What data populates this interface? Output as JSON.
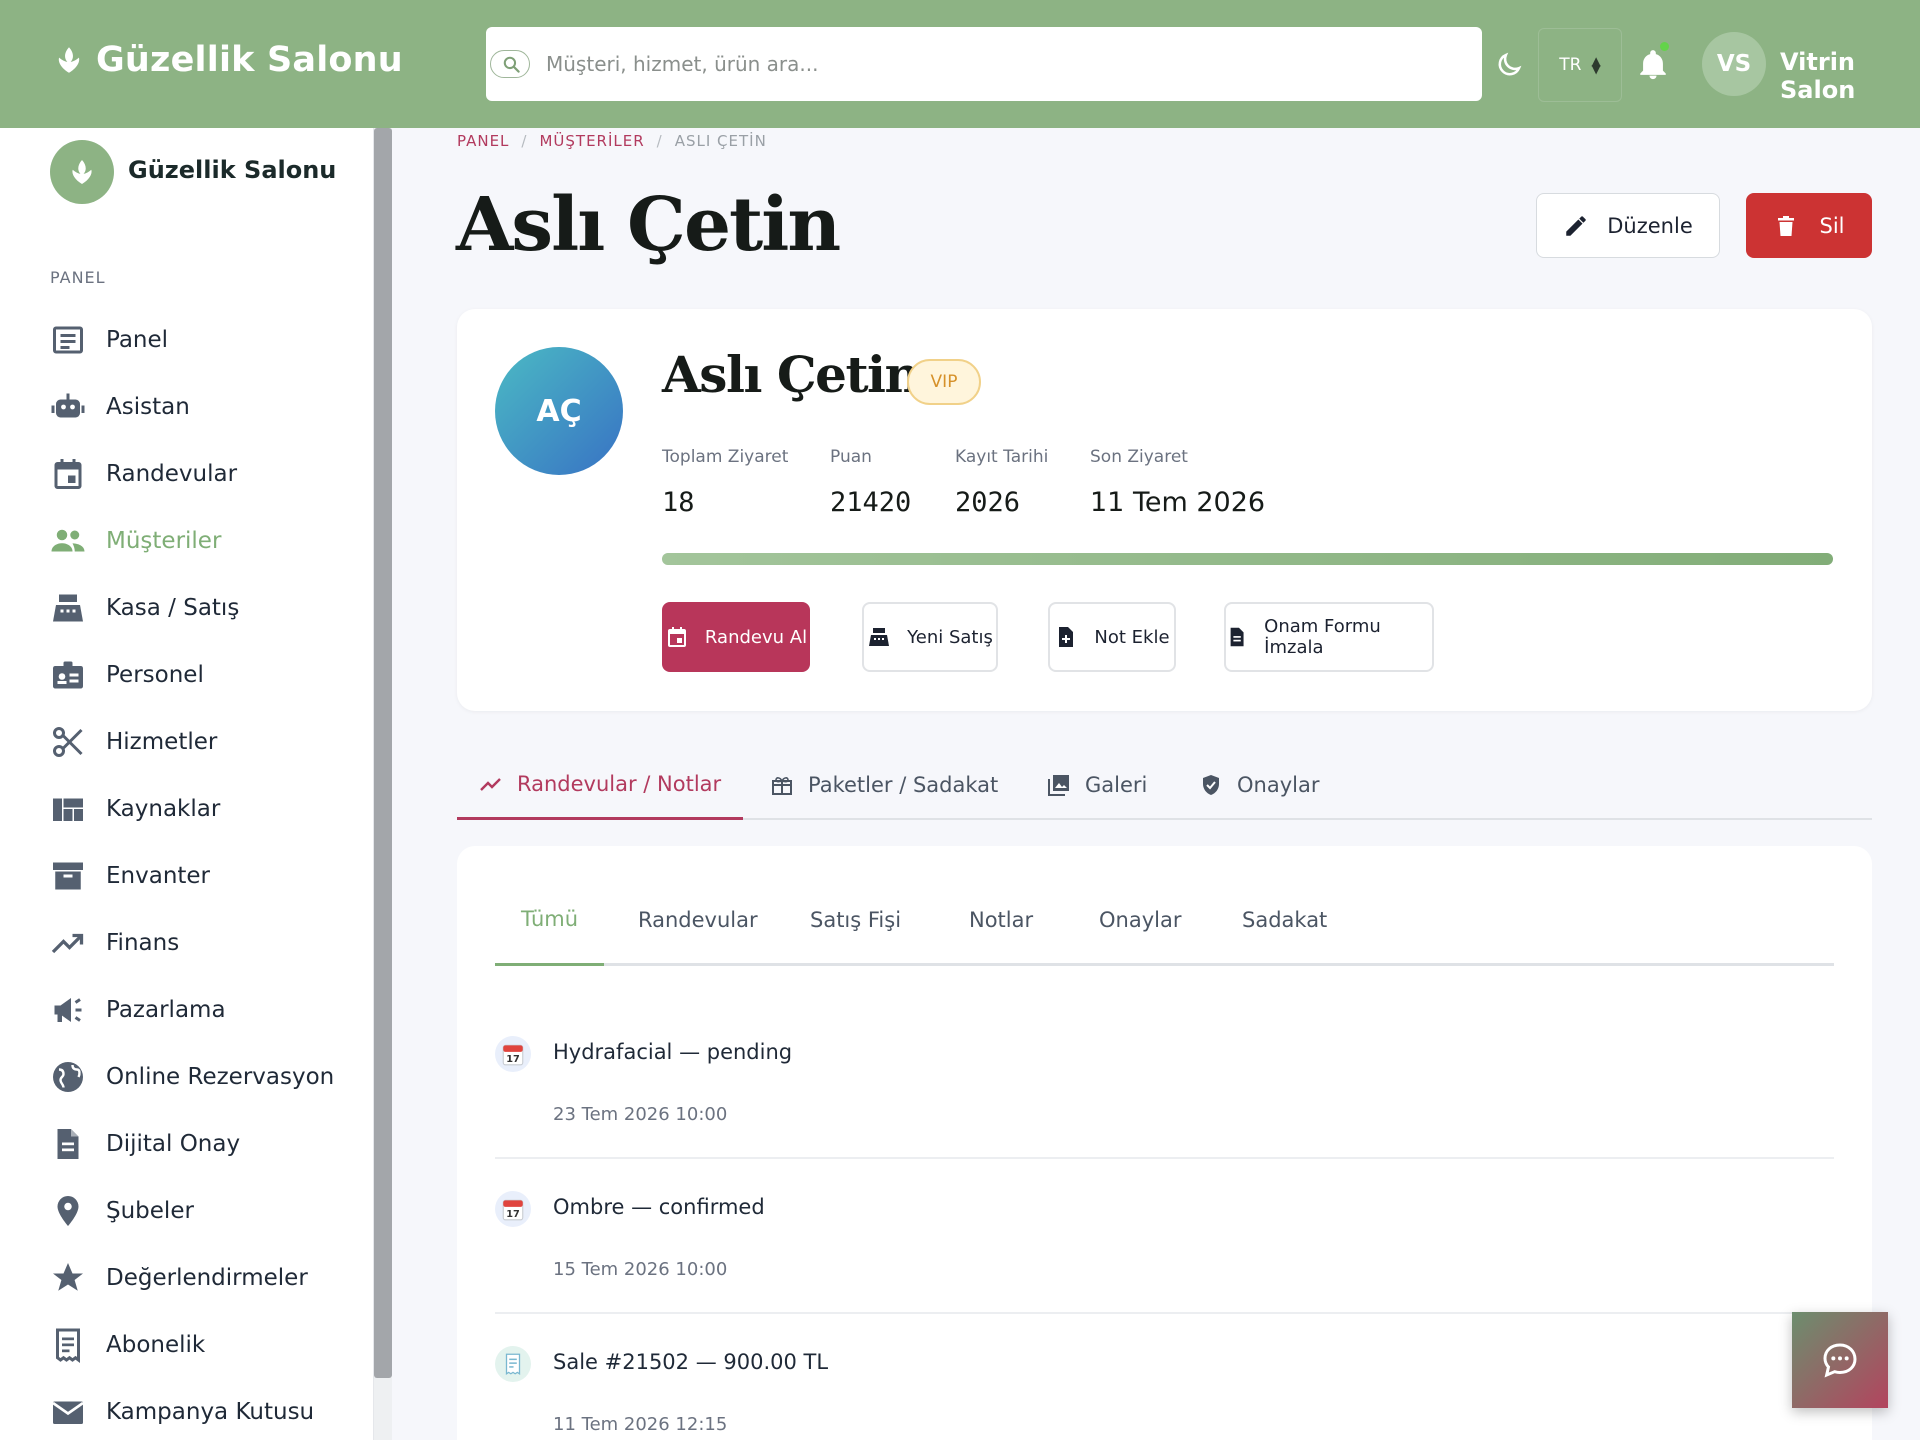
{
  "colors": {
    "brand_green": "#8db384",
    "accent_rose": "#b8365a",
    "danger": "#cc3333",
    "vip_gold": "#d6912a"
  },
  "topbar": {
    "brand": "Güzellik Salonu",
    "search_placeholder": "Müşteri, hizmet, ürün ara...",
    "language": "TR",
    "user_initials": "VS",
    "user_name": "Vitrin Salon"
  },
  "sidebar": {
    "title": "Güzellik Salonu",
    "section": "PANEL",
    "items": [
      {
        "label": "Panel",
        "icon": "dashboard-icon",
        "active": false
      },
      {
        "label": "Asistan",
        "icon": "robot-icon",
        "active": false
      },
      {
        "label": "Randevular",
        "icon": "calendar-icon",
        "active": false
      },
      {
        "label": "Müşteriler",
        "icon": "people-icon",
        "active": true
      },
      {
        "label": "Kasa / Satış",
        "icon": "cash-register-icon",
        "active": false
      },
      {
        "label": "Personel",
        "icon": "badge-icon",
        "active": false
      },
      {
        "label": "Hizmetler",
        "icon": "scissors-icon",
        "active": false
      },
      {
        "label": "Kaynaklar",
        "icon": "grid-icon",
        "active": false
      },
      {
        "label": "Envanter",
        "icon": "archive-icon",
        "active": false
      },
      {
        "label": "Finans",
        "icon": "trending-up-icon",
        "active": false
      },
      {
        "label": "Pazarlama",
        "icon": "megaphone-icon",
        "active": false
      },
      {
        "label": "Online Rezervasyon",
        "icon": "globe-icon",
        "active": false
      },
      {
        "label": "Dijital Onay",
        "icon": "document-icon",
        "active": false
      },
      {
        "label": "Şubeler",
        "icon": "location-pin-icon",
        "active": false
      },
      {
        "label": "Değerlendirmeler",
        "icon": "star-icon",
        "active": false
      },
      {
        "label": "Abonelik",
        "icon": "receipt-icon",
        "active": false
      },
      {
        "label": "Kampanya Kutusu",
        "icon": "mail-icon",
        "active": false
      }
    ]
  },
  "breadcrumb": {
    "items": [
      "PANEL",
      "MÜŞTERİLER",
      "ASLI ÇETİN"
    ]
  },
  "page": {
    "title": "Aslı Çetin",
    "edit_label": "Düzenle",
    "delete_label": "Sil"
  },
  "customer": {
    "initials": "AÇ",
    "name": "Aslı Çetin",
    "badge": "VIP",
    "stats": [
      {
        "label": "Toplam Ziyaret",
        "value": "18"
      },
      {
        "label": "Puan",
        "value": "21420"
      },
      {
        "label": "Kayıt Tarihi",
        "value": "2026"
      },
      {
        "label": "Son Ziyaret",
        "value": "11 Tem 2026"
      }
    ],
    "progress": 1.0,
    "actions": [
      {
        "label": "Randevu Al",
        "icon": "calendar-icon"
      },
      {
        "label": "Yeni Satış",
        "icon": "cash-register-icon"
      },
      {
        "label": "Not Ekle",
        "icon": "note-add-icon"
      },
      {
        "label": "Onam Formu İmzala",
        "icon": "document-icon"
      }
    ]
  },
  "tabs": [
    {
      "label": "Randevular / Notlar",
      "icon": "trending-up-icon",
      "active": true
    },
    {
      "label": "Paketler / Sadakat",
      "icon": "gift-icon",
      "active": false
    },
    {
      "label": "Galeri",
      "icon": "gallery-icon",
      "active": false
    },
    {
      "label": "Onaylar",
      "icon": "verified-icon",
      "active": false
    }
  ],
  "subtabs": [
    {
      "label": "Tümü",
      "active": true
    },
    {
      "label": "Randevular",
      "active": false
    },
    {
      "label": "Satış Fişi",
      "active": false
    },
    {
      "label": "Notlar",
      "active": false
    },
    {
      "label": "Onaylar",
      "active": false
    },
    {
      "label": "Sadakat",
      "active": false
    }
  ],
  "timeline": [
    {
      "icon": "calendar-icon",
      "title": "Hydrafacial — pending",
      "meta": "23 Tem 2026 10:00"
    },
    {
      "icon": "calendar-icon",
      "title": "Ombre — confirmed",
      "meta": "15 Tem 2026 10:00"
    },
    {
      "icon": "receipt-icon",
      "title": "Sale #21502 — 900.00 TL",
      "meta": "11 Tem 2026 12:15"
    }
  ],
  "calendar_icon_day": "17"
}
